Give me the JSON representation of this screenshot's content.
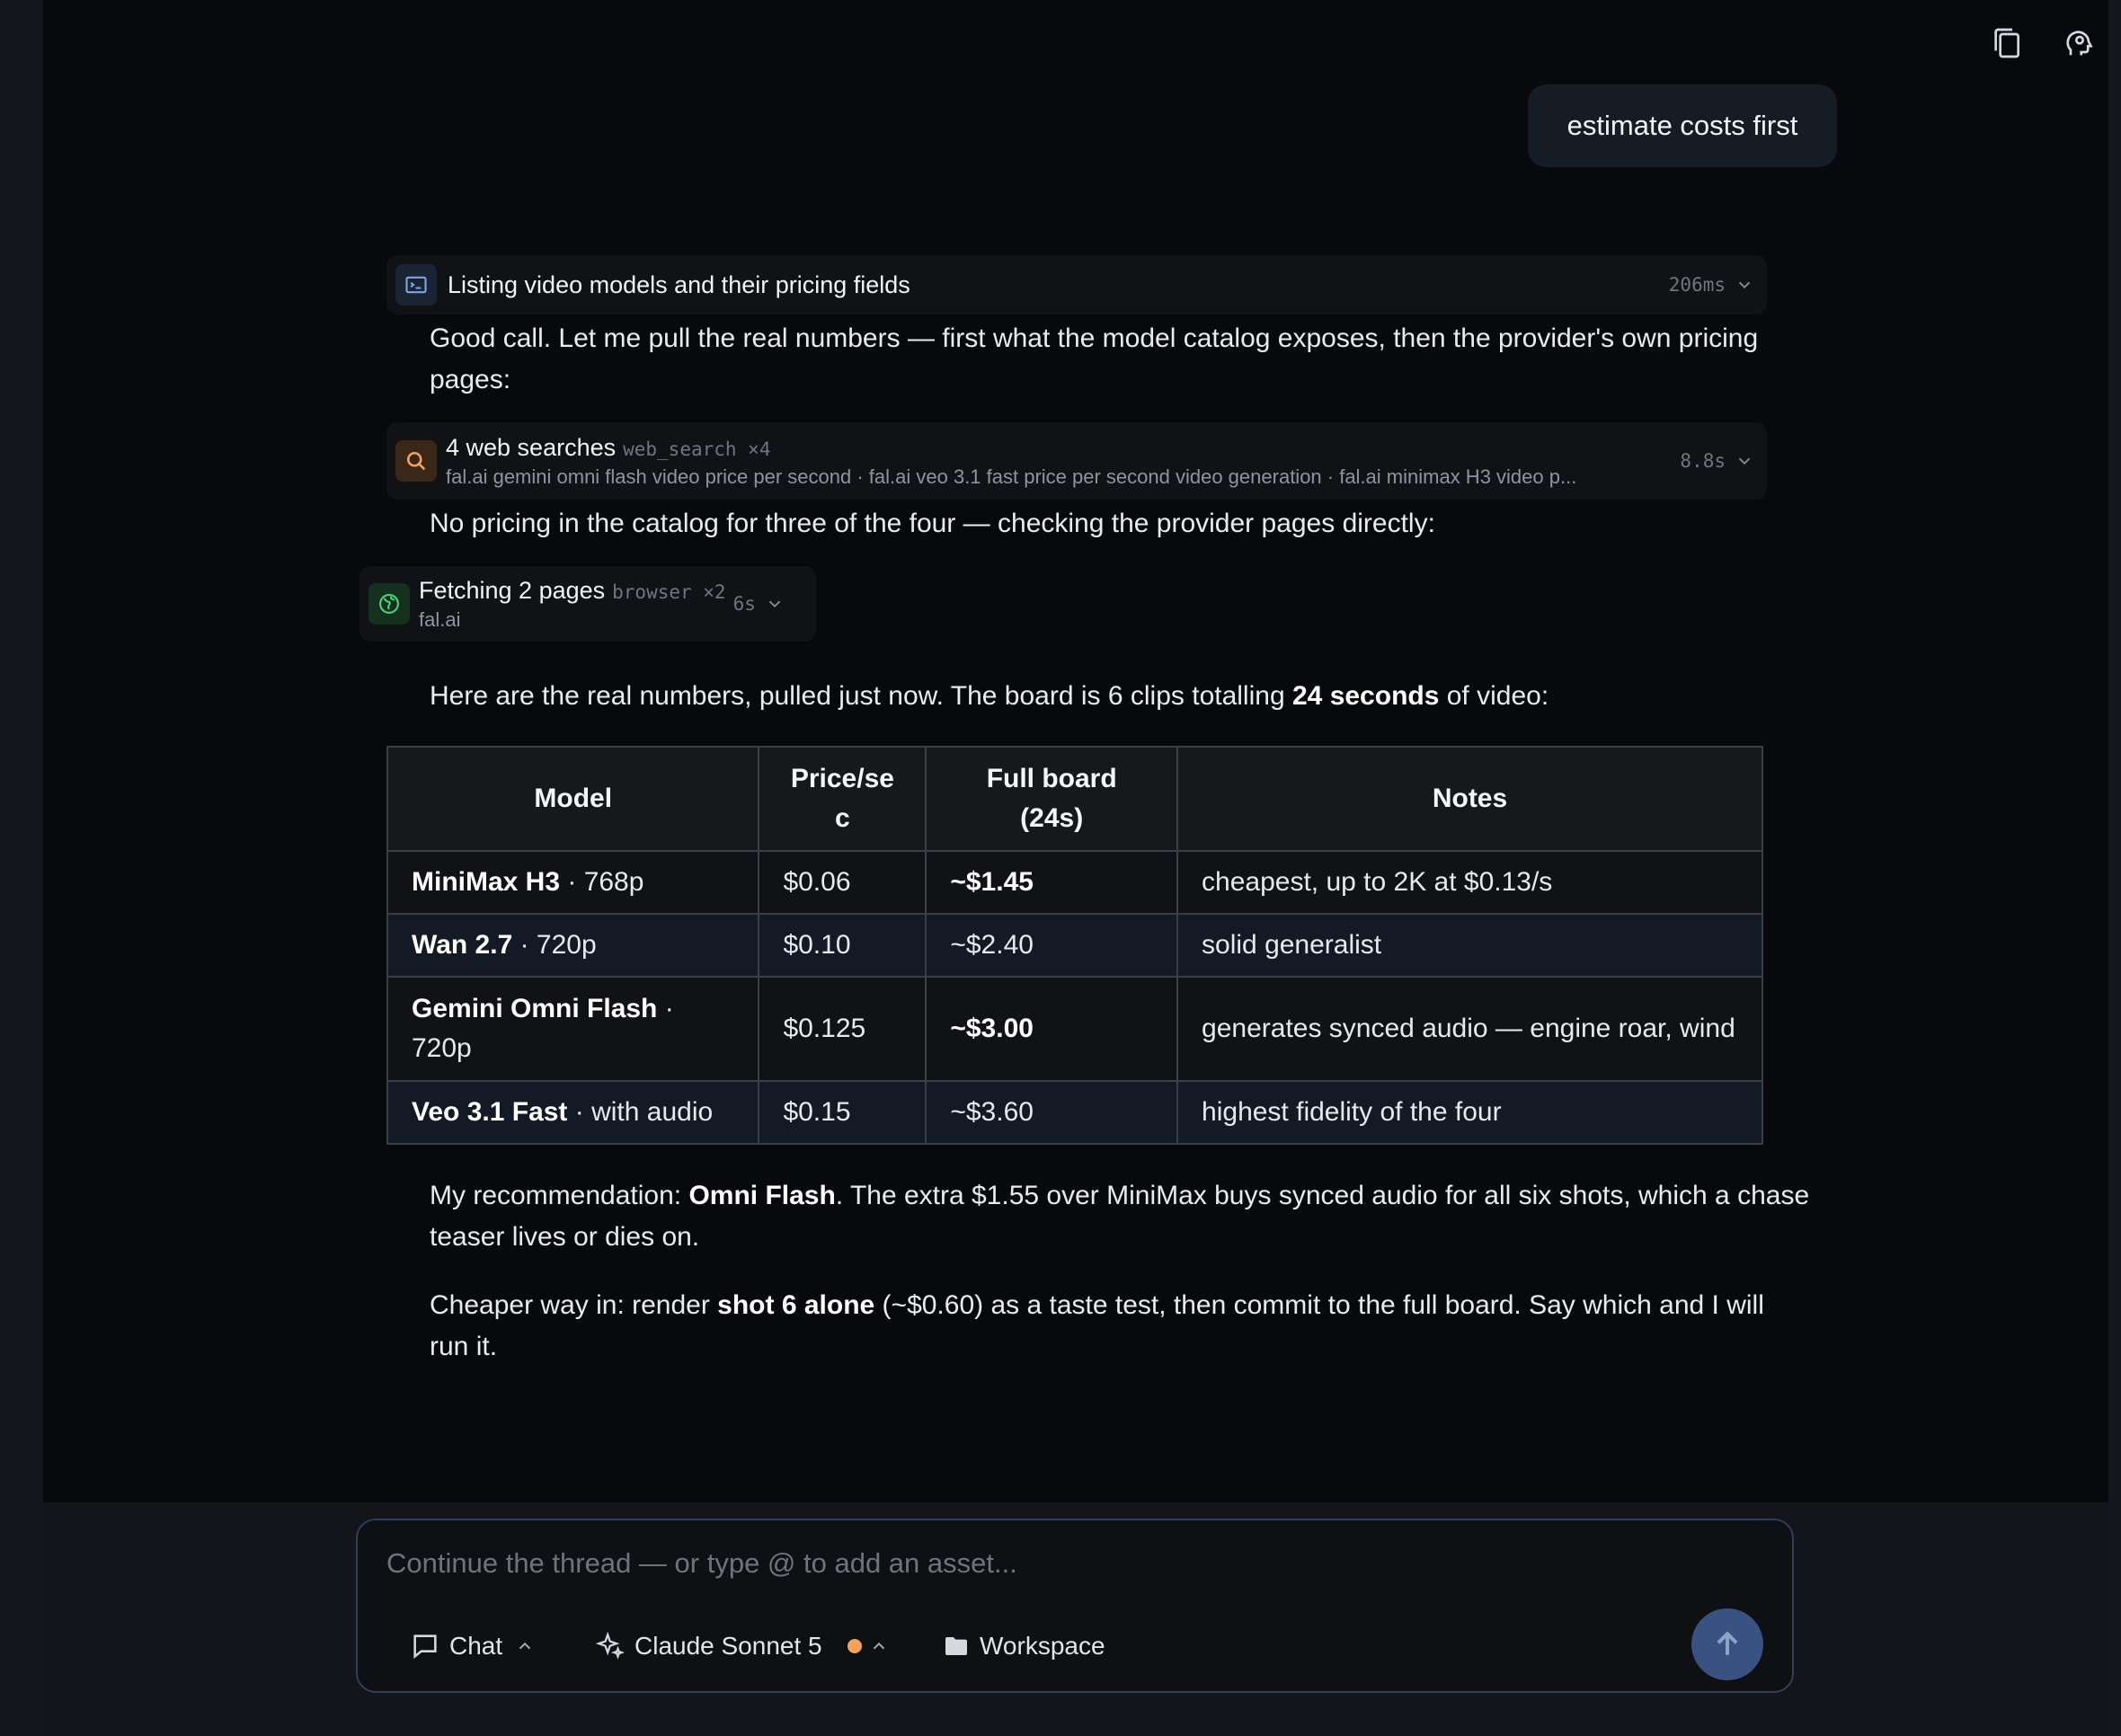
{
  "colors": {
    "background": "#08090c",
    "accent": "#3a5282",
    "search_icon": "#f5a35c",
    "browser_icon": "#4fd17a",
    "model_status_dot": "#f5a35c"
  },
  "header": {
    "copy_icon": "copy-icon",
    "settings_icon": "brain-settings-icon"
  },
  "messages": {
    "user": "estimate costs first",
    "tool1": {
      "title": "Listing video models and their pricing fields",
      "duration": "206ms"
    },
    "para1": "Good call. Let me pull the real numbers — first what the model catalog exposes, then the provider's own pricing pages:",
    "tool2": {
      "title": "4 web searches",
      "tool_name": "web_search ×4",
      "subtitle": "fal.ai gemini omni flash video price per second · fal.ai veo 3.1 fast price per second video generation · fal.ai minimax H3 video p...",
      "duration": "8.8s"
    },
    "para2": "No pricing in the catalog for three of the four — checking the provider pages directly:",
    "tool3": {
      "title": "Fetching 2 pages",
      "tool_name": "browser ×2",
      "subtitle": "fal.ai",
      "duration": "6s"
    },
    "para3": {
      "before": "Here are the real numbers, pulled just now. The board is 6 clips totalling ",
      "bold": "24 seconds",
      "after": " of video:"
    },
    "table": {
      "headers": [
        "Model",
        "Price/se c",
        "Full board (24s)",
        "Notes"
      ],
      "rows": [
        {
          "model": "MiniMax H3",
          "variant": " · 768p",
          "price": "$0.06",
          "board": "~$1.45",
          "board_bold": true,
          "notes": "cheapest, up to 2K at $0.13/s"
        },
        {
          "model": "Wan 2.7",
          "variant": " · 720p",
          "price": "$0.10",
          "board": "~$2.40",
          "board_bold": false,
          "notes": "solid generalist"
        },
        {
          "model": "Gemini Omni Flash",
          "variant": " · 720p",
          "price": "$0.125",
          "board": "~$3.00",
          "board_bold": true,
          "notes": "generates synced audio — engine roar, wind"
        },
        {
          "model": "Veo 3.1 Fast",
          "variant": " · with audio",
          "price": "$0.15",
          "board": "~$3.60",
          "board_bold": false,
          "notes": "highest fidelity of the four"
        }
      ]
    },
    "para4": {
      "before": "My recommendation: ",
      "bold": "Omni Flash",
      "after": ". The extra $1.55 over MiniMax buys synced audio for all six shots, which a chase teaser lives or dies on."
    },
    "para5": {
      "before": "Cheaper way in: render ",
      "bold": "shot 6 alone",
      "after": " (~$0.60) as a taste test, then commit to the full board. Say which and I will run it."
    }
  },
  "composer": {
    "placeholder": "Continue the thread — or type @ to add an asset...",
    "mode_label": "Chat",
    "model_label": "Claude Sonnet 5",
    "workspace_label": "Workspace"
  }
}
